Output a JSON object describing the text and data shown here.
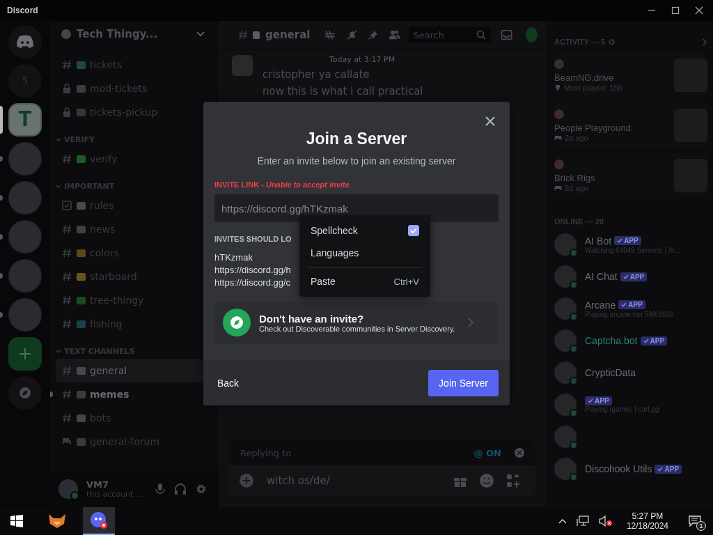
{
  "window": {
    "title": "Discord"
  },
  "servers": [
    {
      "kind": "home",
      "selected": false,
      "unread": false
    },
    {
      "kind": "folder",
      "label": "5",
      "selected": false,
      "unread": false
    },
    {
      "kind": "server",
      "label": "T",
      "selected": true,
      "unread": false
    },
    {
      "kind": "server",
      "selected": false,
      "unread": true
    },
    {
      "kind": "server",
      "selected": false,
      "unread": true
    },
    {
      "kind": "server",
      "selected": false,
      "unread": true
    },
    {
      "kind": "server",
      "selected": false,
      "unread": true
    },
    {
      "kind": "server",
      "selected": false,
      "unread": true
    },
    {
      "kind": "add",
      "selected": false,
      "unread": false
    },
    {
      "kind": "discover",
      "selected": false,
      "unread": false
    }
  ],
  "sidebar": {
    "server_name": "Tech Thingy...",
    "sections": [
      {
        "channels": [
          {
            "kind": "text",
            "name": "tickets",
            "color": "#1d4a45",
            "selected": false,
            "unread": false
          },
          {
            "kind": "locked",
            "name": "mod-tickets",
            "color": "#3c3c3c",
            "selected": false,
            "unread": false
          },
          {
            "kind": "locked",
            "name": "tickets-pickup",
            "color": "#353535",
            "selected": false,
            "unread": false
          }
        ]
      },
      {
        "title": "VERIFY",
        "channels": [
          {
            "kind": "text",
            "name": "verify",
            "color": "#1f5a25",
            "selected": false,
            "unread": false
          }
        ]
      },
      {
        "title": "IMPORTANT",
        "channels": [
          {
            "kind": "rules",
            "name": "rules",
            "color": "#4a4a4a",
            "selected": false,
            "unread": false
          },
          {
            "kind": "text",
            "name": "news",
            "color": "#404040",
            "selected": false,
            "unread": false
          },
          {
            "kind": "text",
            "name": "colors",
            "color": "#5a4a18",
            "selected": false,
            "unread": false
          },
          {
            "kind": "text",
            "name": "starboard",
            "color": "#665520",
            "selected": false,
            "unread": false
          },
          {
            "kind": "text",
            "name": "tree-thingy",
            "color": "#1a4a20",
            "selected": false,
            "unread": false
          },
          {
            "kind": "text",
            "name": "fishing",
            "color": "#1a4048",
            "selected": false,
            "unread": false
          }
        ]
      },
      {
        "title": "TEXT CHANNELS",
        "channels": [
          {
            "kind": "text",
            "name": "general",
            "color": "#45484f",
            "selected": true,
            "unread": false
          },
          {
            "kind": "text",
            "name": "memes",
            "color": "#3c3c3c",
            "selected": false,
            "unread": true
          },
          {
            "kind": "text",
            "name": "bots",
            "color": "#454545",
            "selected": false,
            "unread": false
          },
          {
            "kind": "forum",
            "name": "general-forum",
            "color": "#3c3c3c",
            "selected": false,
            "unread": false
          }
        ]
      }
    ]
  },
  "user": {
    "name": "VM7",
    "status": "this account ..."
  },
  "chat": {
    "channel": "general",
    "search_placeholder": "Search",
    "message": {
      "time": "Today at 3:17 PM",
      "lines": [
        "cristopher ya callate",
        "now this is what i call practical"
      ]
    },
    "reply": {
      "label": "Replying to",
      "mention": "@ ON"
    },
    "input_value": "witch os/de/"
  },
  "members": {
    "activity_header": "ACTIVITY — 5",
    "activities": [
      {
        "game": "BeamNG.drive",
        "kind": "trophy",
        "detail": "Most played: 15h"
      },
      {
        "game": "People Playground",
        "kind": "controller",
        "detail": "2d ago"
      },
      {
        "game": "Brick Rigs",
        "kind": "controller",
        "detail": "2d ago"
      }
    ],
    "online_header": "ONLINE — 20",
    "list": [
      {
        "name": "AI Bot",
        "color": "#6a6c72",
        "online": true,
        "badge": "APP",
        "status": "Watching 64049 Servers! | /h..."
      },
      {
        "name": "AI Chat",
        "color": "#6a6c72",
        "online": true,
        "badge": "APP"
      },
      {
        "name": "Arcane",
        "color": "#6a6c72",
        "online": true,
        "badge": "APP",
        "status": "Playing arcane.bot 599/1636"
      },
      {
        "name": "Captcha.bot",
        "color": "#2f7f7a",
        "online": true,
        "badge": "APP"
      },
      {
        "name": "CrypticData",
        "color": "#6a6c72",
        "online": true
      },
      {
        "online": true,
        "badge": "APP",
        "status": "Playing /games | carl.gg"
      },
      {
        "online": true
      },
      {
        "name": "Discohook Utils",
        "color": "#6a6c72",
        "online": true,
        "badge": "APP"
      }
    ]
  },
  "modal": {
    "title": "Join a Server",
    "subtitle": "Enter an invite below to join an existing server",
    "label": "INVITE LINK - *Unable to accept invite*",
    "value": "https://discord.gg/hTKzmak",
    "examples_title": "INVITES SHOULD LO",
    "examples": [
      "hTKzmak",
      "https://discord.gg/h",
      "https://discord.gg/c"
    ],
    "discovery": {
      "title": "Don't have an invite?",
      "text": "Check out Discoverable communities in Server Discovery."
    },
    "back": "Back",
    "submit": "Join Server"
  },
  "context_menu": {
    "items": [
      {
        "kind": "check",
        "label": "Spellcheck",
        "checked": true
      },
      {
        "kind": "item",
        "label": "Languages"
      },
      {
        "kind": "separator"
      },
      {
        "kind": "item",
        "label": "Paste",
        "shortcut": "Ctrl+V"
      }
    ]
  },
  "taskbar": {
    "apps": [
      {
        "kind": "fox",
        "selected": false
      },
      {
        "kind": "discord",
        "selected": true
      }
    ],
    "time": "5:27 PM",
    "date": "12/18/2024",
    "notifications": "1"
  }
}
